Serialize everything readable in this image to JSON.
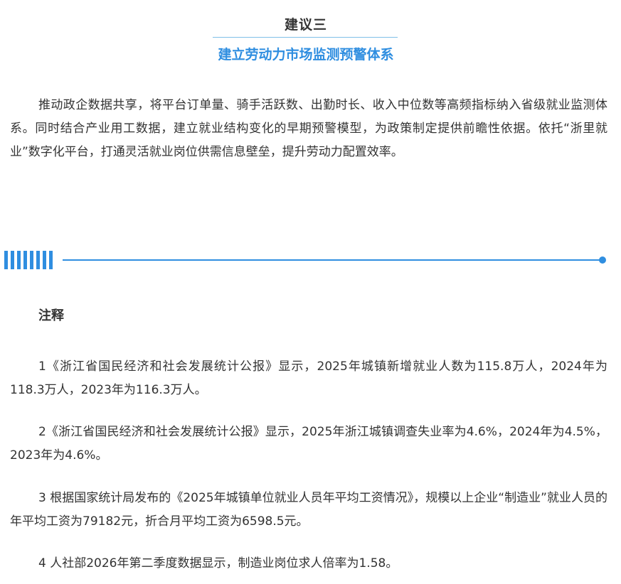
{
  "header": {
    "suggestion_label": "建议三",
    "section_title": "建立劳动力市场监测预警体系"
  },
  "body": {
    "paragraph": "推动政企数据共享，将平台订单量、骑手活跃数、出勤时长、收入中位数等高频指标纳入省级就业监测体系。同时结合产业用工数据，建立就业结构变化的早期预警模型，为政策制定提供前瞻性依据。依托“浙里就业”数字化平台，打通灵活就业岗位供需信息壁垒，提升劳动力配置效率。"
  },
  "separator": {
    "accent_color": "#2f8ee0",
    "bar_count": 8
  },
  "notes": {
    "heading": "注释",
    "items": [
      "1《浙江省国民经济和社会发展统计公报》显示，2025年城镇新增就业人数为115.8万人，2024年为118.3万人，2023年为116.3万人。",
      "2《浙江省国民经济和社会发展统计公报》显示，2025年浙江城镇调查失业率为4.6%，2024年为4.5%，2023年为4.6%。",
      "3 根据国家统计局发布的《2025年城镇单位就业人员年平均工资情况》，规模以上企业“制造业”就业人员的年平均工资为79182元，折合月平均工资为6598.5元。",
      "4 人社部2026年第二季度数据显示，制造业岗位求人倍率为1.58。"
    ]
  }
}
